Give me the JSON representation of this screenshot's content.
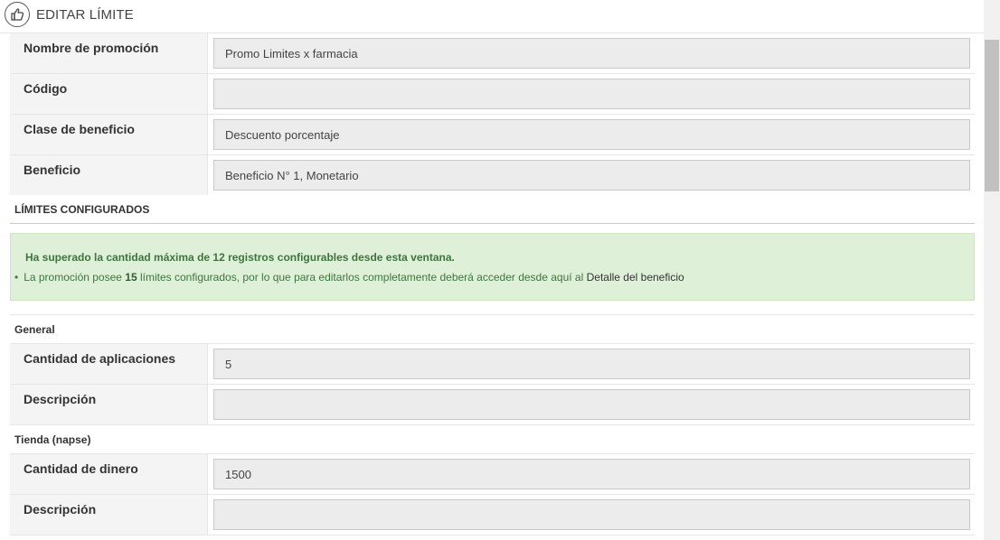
{
  "header": {
    "title": "EDITAR LÍMITE",
    "icon": "thumbs-up-icon"
  },
  "promotion_form": {
    "fields": [
      {
        "label": "Nombre de promoción",
        "value": "Promo Limites x farmacia"
      },
      {
        "label": "Código",
        "value": ""
      },
      {
        "label": "Clase de beneficio",
        "value": "Descuento porcentaje"
      },
      {
        "label": "Beneficio",
        "value": "Beneficio N° 1, Monetario"
      }
    ]
  },
  "limits_section": {
    "title": "LÍMITES CONFIGURADOS",
    "alert": {
      "title": "Ha superado la cantidad máxima de 12 registros configurables desde esta ventana.",
      "line_prefix": "La promoción posee ",
      "line_count": "15",
      "line_middle": " límites configurados, por lo que para editarlos completamente deberá acceder desde aquí al ",
      "link_text": "Detalle del beneficio"
    }
  },
  "groups": [
    {
      "title": "General",
      "fields": [
        {
          "label": "Cantidad de aplicaciones",
          "value": "5"
        },
        {
          "label": "Descripción",
          "value": ""
        }
      ]
    },
    {
      "title": "Tienda (napse)",
      "fields": [
        {
          "label": "Cantidad de dinero",
          "value": "1500"
        },
        {
          "label": "Descripción",
          "value": ""
        }
      ]
    }
  ],
  "colors": {
    "alert_bg": "#dff0d8",
    "alert_text": "#3c763d",
    "section_underline": "#e8d44d",
    "label_bg": "#f4f4f4",
    "input_bg": "#ececec"
  }
}
